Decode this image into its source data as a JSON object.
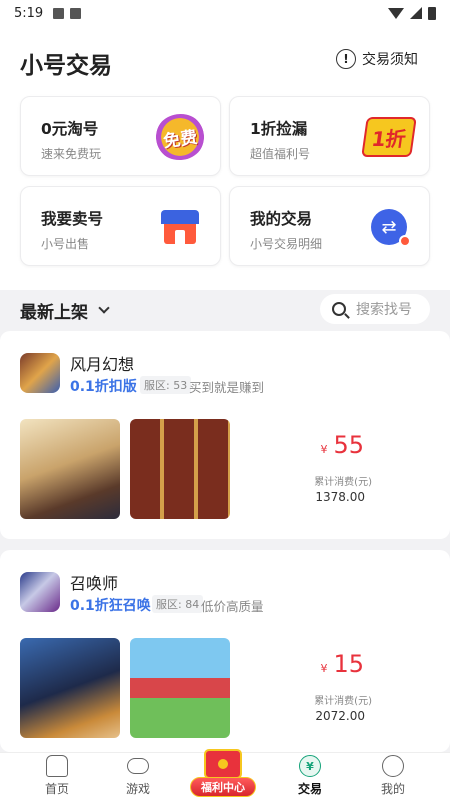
{
  "status_bar": {
    "time": "5:19"
  },
  "header": {
    "title": "小号交易",
    "notice_label": "交易须知"
  },
  "cards": [
    {
      "title": "0元淘号",
      "subtitle": "速来免费玩",
      "icon": "free-badge-icon",
      "badge_text": "免费"
    },
    {
      "title": "1折捡漏",
      "subtitle": "超值福利号",
      "icon": "discount-badge-icon",
      "badge_text": "1折"
    },
    {
      "title": "我要卖号",
      "subtitle": "小号出售",
      "icon": "shop-icon"
    },
    {
      "title": "我的交易",
      "subtitle": "小号交易明细",
      "icon": "swap-icon"
    }
  ],
  "filter": {
    "label": "最新上架",
    "search_placeholder": "搜索找号"
  },
  "listings": [
    {
      "name": "风月幻想",
      "version": "0.1折扣版",
      "server": "服区: 53",
      "desc": "买到就是赚到",
      "currency": "¥",
      "price": "55",
      "consume_label": "累计消费(元)",
      "consume_value": "1378.00"
    },
    {
      "name": "召唤师",
      "version": "0.1折狂召唤",
      "server": "服区: 84",
      "desc": "低价高质量",
      "currency": "¥",
      "price": "15",
      "consume_label": "累计消费(元)",
      "consume_value": "2072.00"
    }
  ],
  "tabbar": {
    "tabs": [
      {
        "label": "首页",
        "icon": "home-icon"
      },
      {
        "label": "游戏",
        "icon": "gamepad-icon"
      },
      {
        "label": "福利中心",
        "icon": "red-envelope-icon"
      },
      {
        "label": "交易",
        "icon": "trade-icon",
        "active": true
      },
      {
        "label": "我的",
        "icon": "profile-icon"
      }
    ]
  },
  "colors": {
    "accent_blue": "#3b73e6",
    "price_red": "#e8323c",
    "active_green": "#16a37a"
  }
}
